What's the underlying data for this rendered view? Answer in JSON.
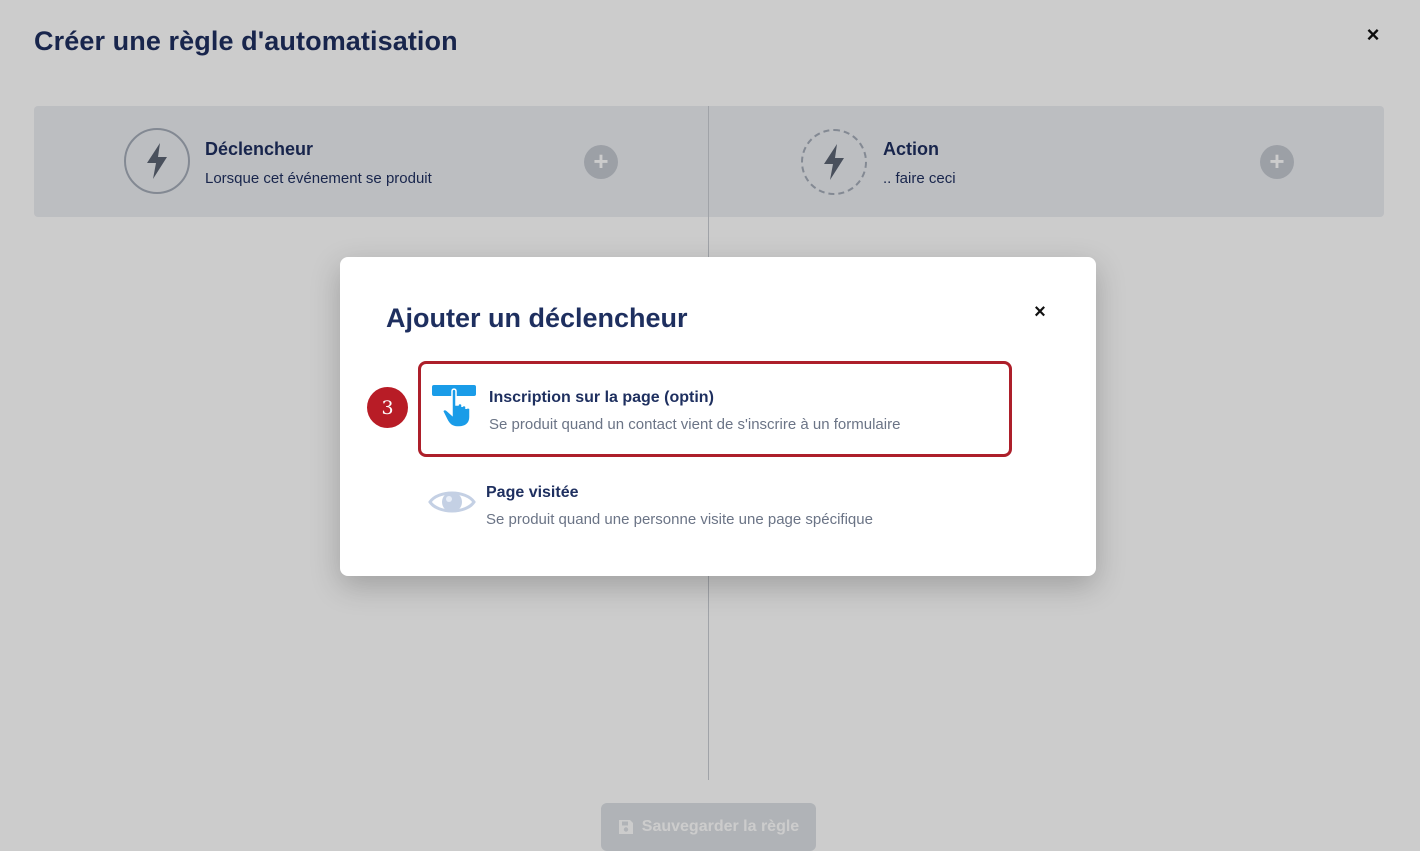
{
  "page": {
    "title": "Créer une règle d'automatisation",
    "close_label": "×",
    "trigger_step": {
      "title": "Déclencheur",
      "subtitle": "Lorsque cet événement se produit",
      "icon": "lightning-bolt-icon",
      "add_label": "+"
    },
    "action_step": {
      "title": "Action",
      "subtitle": ".. faire ceci",
      "icon": "lightning-cycle-icon",
      "add_label": "+"
    },
    "save_button": {
      "label": "Sauvegarder la règle",
      "icon": "floppy-disk-icon"
    }
  },
  "modal": {
    "title": "Ajouter un déclencheur",
    "close_label": "×",
    "options": [
      {
        "title": "Inscription sur la page (optin)",
        "description": "Se produit quand un contact vient de s'inscrire à un formulaire",
        "icon": "hand-tap-form-icon",
        "highlighted": true
      },
      {
        "title": "Page visitée",
        "description": "Se produit quand une personne visite une page spécifique",
        "icon": "eye-icon",
        "highlighted": false
      }
    ]
  },
  "step_marker": {
    "label": "3"
  },
  "colors": {
    "heading": "#1e2f5f",
    "highlight_border": "#ad1f2a",
    "marker": "#b81c26",
    "accent_blue": "#1a9ce8"
  }
}
